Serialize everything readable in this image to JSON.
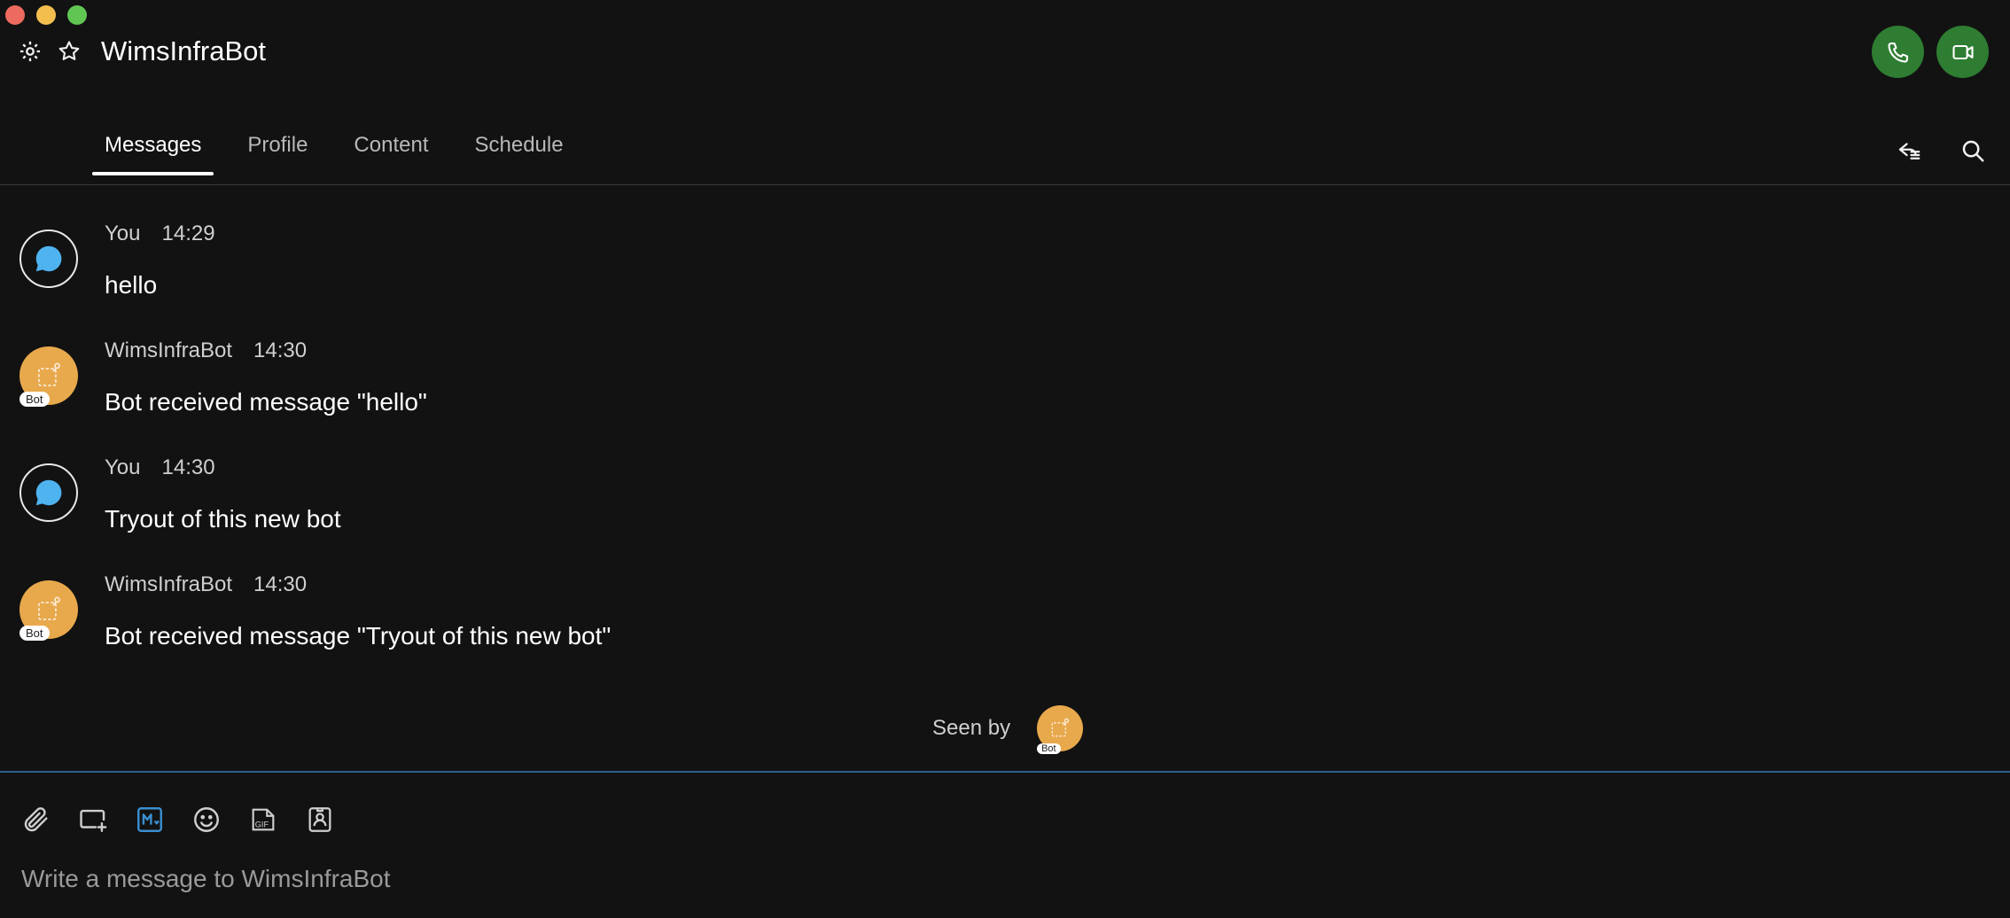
{
  "window": {
    "title": "WimsInfraBot"
  },
  "header": {
    "icons": [
      "gear-icon",
      "star-icon"
    ],
    "call_icons": [
      "phone-icon",
      "video-icon"
    ],
    "call_color": "#2e7d32"
  },
  "tabs": [
    {
      "label": "Messages",
      "active": true
    },
    {
      "label": "Profile",
      "active": false
    },
    {
      "label": "Content",
      "active": false
    },
    {
      "label": "Schedule",
      "active": false
    }
  ],
  "tab_actions": [
    "share-icon",
    "search-icon"
  ],
  "messages": [
    {
      "sender": "You",
      "time": "14:29",
      "text": "hello",
      "avatar": "chat-bubble-icon"
    },
    {
      "sender": "WimsInfraBot",
      "time": "14:30",
      "text": "Bot received message \"hello\"",
      "avatar": "bot-icon",
      "badge": "Bot"
    },
    {
      "sender": "You",
      "time": "14:30",
      "text": "Tryout of this new bot",
      "avatar": "chat-bubble-icon"
    },
    {
      "sender": "WimsInfraBot",
      "time": "14:30",
      "text": "Bot received message \"Tryout of this new bot\"",
      "avatar": "bot-icon",
      "badge": "Bot"
    }
  ],
  "seen_by": {
    "label": "Seen by",
    "badge": "Bot"
  },
  "composer": {
    "tools": [
      "attach-icon",
      "add-screen-icon",
      "markdown-icon",
      "emoji-icon",
      "gif-icon",
      "contact-icon"
    ],
    "placeholder": "Write a message to WimsInfraBot"
  },
  "colors": {
    "accent": "#2c5f8a",
    "bot_avatar": "#e8a94c",
    "bubble": "#4fb3f0"
  }
}
